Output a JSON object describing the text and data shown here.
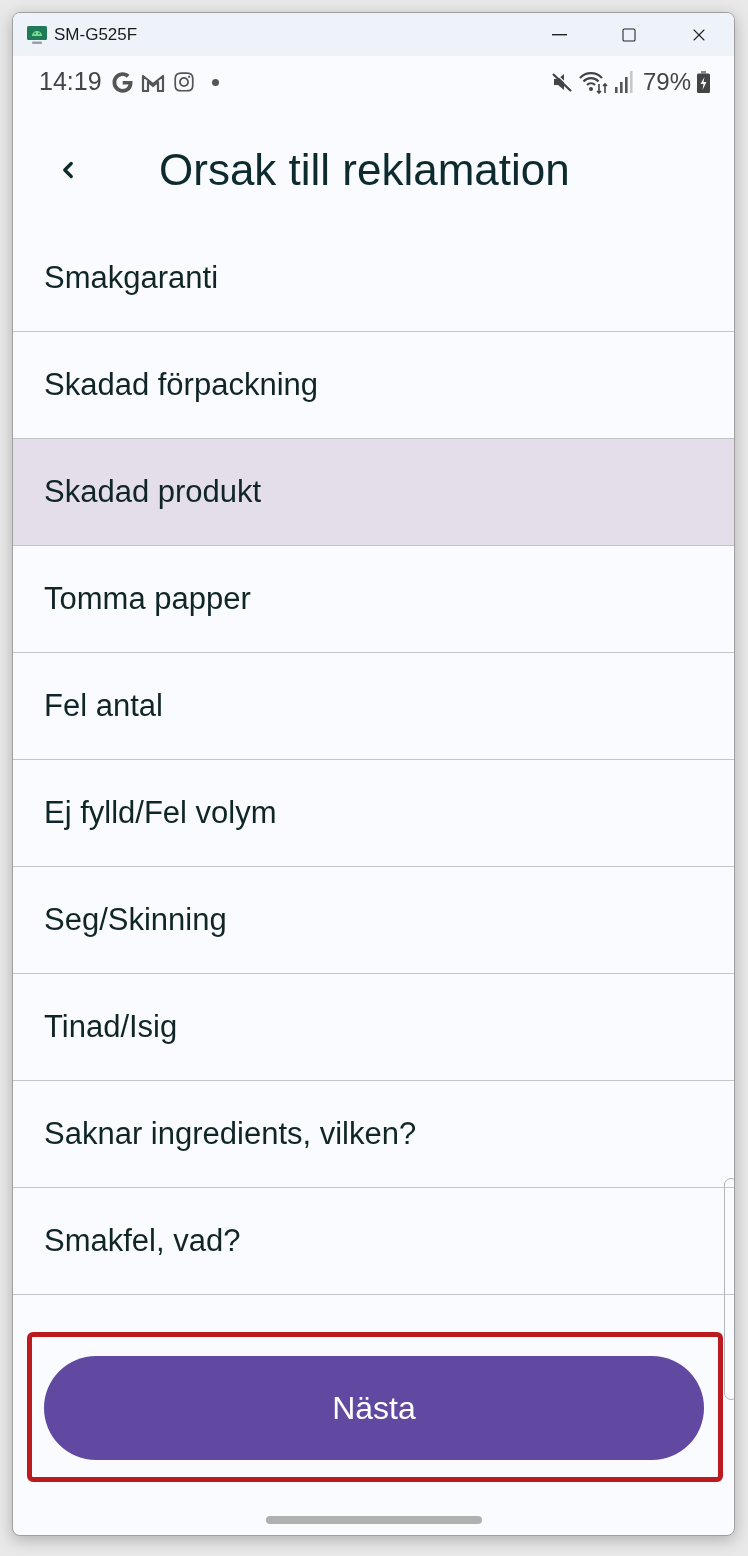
{
  "window": {
    "title": "SM-G525F"
  },
  "status_bar": {
    "time": "14:19",
    "battery": "79%"
  },
  "header": {
    "title": "Orsak till reklamation"
  },
  "reasons": [
    {
      "label": "Smakgaranti",
      "selected": false
    },
    {
      "label": "Skadad förpackning",
      "selected": false
    },
    {
      "label": "Skadad produkt",
      "selected": true
    },
    {
      "label": "Tomma papper",
      "selected": false
    },
    {
      "label": "Fel antal",
      "selected": false
    },
    {
      "label": "Ej fylld/Fel volym",
      "selected": false
    },
    {
      "label": "Seg/Skinning",
      "selected": false
    },
    {
      "label": "Tinad/Isig",
      "selected": false
    },
    {
      "label": "Saknar ingredients, vilken?",
      "selected": false
    },
    {
      "label": "Smakfel, vad?",
      "selected": false
    }
  ],
  "next_button": {
    "label": "Nästa",
    "highlighted": true
  }
}
